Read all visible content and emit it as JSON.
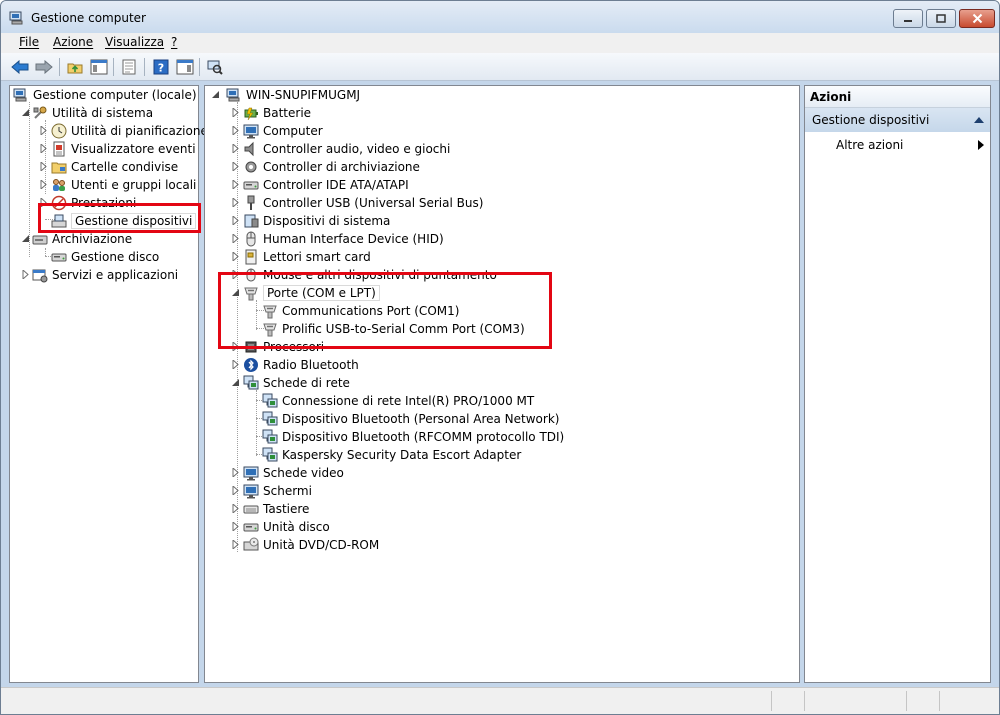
{
  "window": {
    "title": "Gestione computer",
    "title_icon": "computer-management-icon"
  },
  "menu": [
    "File",
    "Azione",
    "Visualizza",
    "?"
  ],
  "left_tree": {
    "root": "Gestione computer (locale)",
    "utilita": "Utilità di sistema",
    "pianificazione": "Utilità di pianificazione",
    "eventi": "Visualizzatore eventi",
    "cartelle": "Cartelle condivise",
    "utenti": "Utenti e gruppi locali",
    "prestazioni": "Prestazioni",
    "dispositivi": "Gestione dispositivi",
    "archiviazione": "Archiviazione",
    "disco": "Gestione disco",
    "servizi": "Servizi e applicazioni"
  },
  "device_tree": {
    "root": "WIN-SNUPIFMUGMJ",
    "batterie": "Batterie",
    "computer": "Computer",
    "audio": "Controller audio, video e giochi",
    "archiviazione": "Controller di archiviazione",
    "ide": "Controller IDE ATA/ATAPI",
    "usb": "Controller USB (Universal Serial Bus)",
    "sistema": "Dispositivi di sistema",
    "hid": "Human Interface Device (HID)",
    "smartcard": "Lettori smart card",
    "mouse": "Mouse e altri dispositivi di puntamento",
    "porte": "Porte (COM e LPT)",
    "com1": "Communications Port (COM1)",
    "com3": "Prolific USB-to-Serial Comm Port (COM3)",
    "processori": "Processori",
    "bluetooth": "Radio Bluetooth",
    "rete": "Schede di rete",
    "intel": "Connessione di rete Intel(R) PRO/1000 MT",
    "bt_pan": "Dispositivo Bluetooth (Personal Area Network)",
    "bt_rfcomm": "Dispositivo Bluetooth (RFCOMM protocollo TDI)",
    "kaspersky": "Kaspersky Security Data Escort Adapter",
    "video": "Schede video",
    "schermi": "Schermi",
    "tastiere": "Tastiere",
    "unita_disco": "Unità disco",
    "dvd": "Unità DVD/CD-ROM"
  },
  "actions": {
    "title": "Azioni",
    "section": "Gestione dispositivi",
    "more": "Altre azioni"
  },
  "colors": {
    "highlight": "#e30613",
    "selection": "#ffffff",
    "frame": "#c4d6ea"
  }
}
